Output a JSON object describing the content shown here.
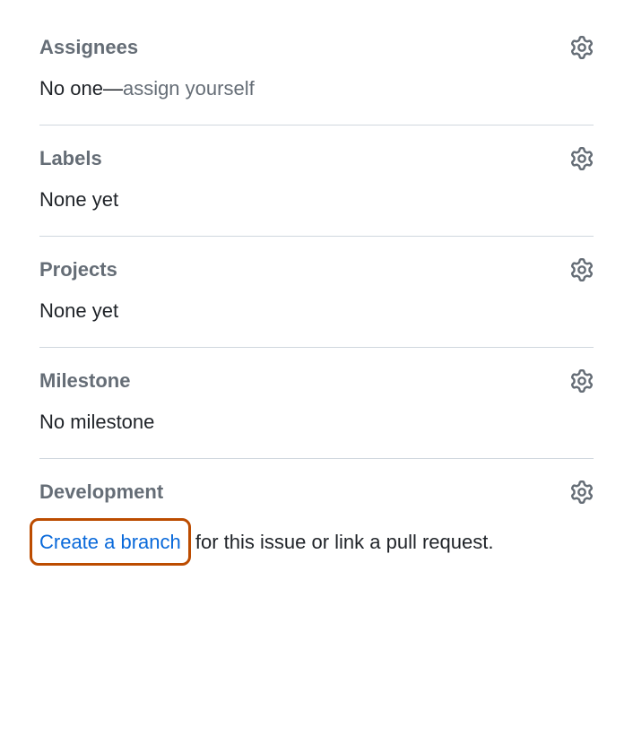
{
  "assignees": {
    "title": "Assignees",
    "none_prefix": "No one",
    "dash": "—",
    "assign_self": "assign yourself"
  },
  "labels": {
    "title": "Labels",
    "none": "None yet"
  },
  "projects": {
    "title": "Projects",
    "none": "None yet"
  },
  "milestone": {
    "title": "Milestone",
    "none": "No milestone"
  },
  "development": {
    "title": "Development",
    "create_branch": "Create a branch",
    "suffix": " for this issue or link a pull request."
  }
}
